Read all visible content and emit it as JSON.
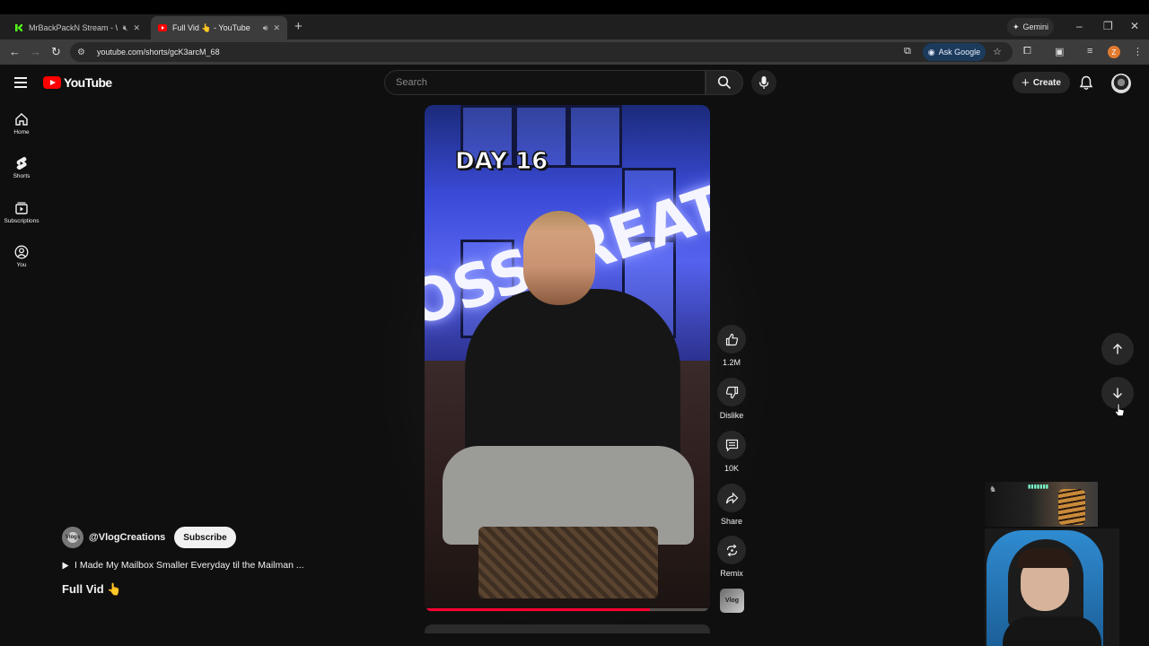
{
  "browser": {
    "tabs": [
      {
        "title": "MrBackPackN Stream - Wat",
        "favicon": "kick-icon",
        "favicon_color": "#53fc18",
        "audio": "mute-icon",
        "active": false
      },
      {
        "title": "Full Vid 👆 - YouTube",
        "favicon": "youtube-icon",
        "favicon_color": "#ff0000",
        "audio": "speaker-icon",
        "active": true
      }
    ],
    "new_tab": "+",
    "gemini_label": "Gemini",
    "url": "youtube.com/shorts/gcK3arcM_68",
    "ask_google_label": "Ask Google",
    "profile_initial": "Z"
  },
  "masthead": {
    "logo_text": "YouTube",
    "search_placeholder": "Search",
    "create_label": "Create"
  },
  "left_rail": [
    {
      "label": "Home",
      "icon": "home-icon"
    },
    {
      "label": "Shorts",
      "icon": "shorts-icon"
    },
    {
      "label": "Subscriptions",
      "icon": "subscriptions-icon"
    },
    {
      "label": "You",
      "icon": "you-icon"
    }
  ],
  "video": {
    "overlay_text": "DAY 16",
    "neon_sign_text": "OSSCREATION",
    "progress": 0.79
  },
  "actions": {
    "like_count": "1.2M",
    "dislike_label": "Dislike",
    "comments_count": "10K",
    "share_label": "Share",
    "remix_label": "Remix",
    "sound_thumb_text": "Vlog"
  },
  "channel": {
    "handle": "@VlogCreations",
    "avatar_text": "Vlogs",
    "subscribe_label": "Subscribe"
  },
  "linked_video_title": "I Made My Mailbox Smaller Everyday til the Mailman ...",
  "short_title": "Full Vid 👆",
  "colors": {
    "background": "#0f0f0f",
    "accent_red": "#ff0000",
    "progress_red": "#ff0033",
    "button_gray": "#272727"
  }
}
